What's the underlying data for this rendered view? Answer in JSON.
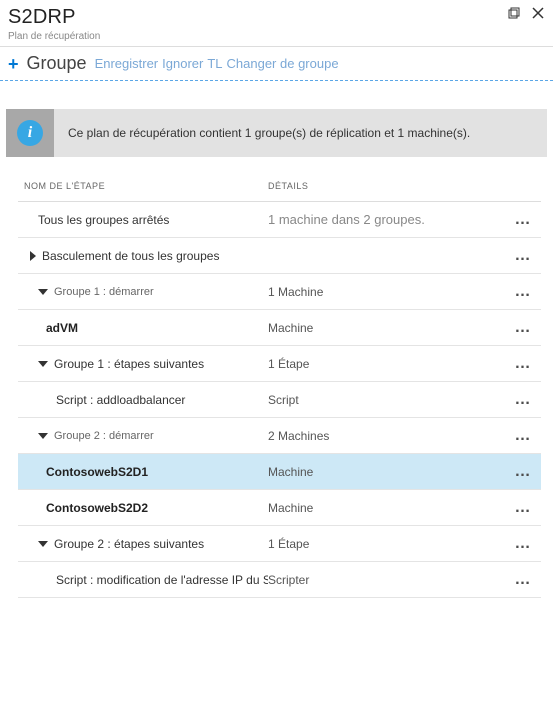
{
  "header": {
    "title": "S2DRP",
    "subtitle": "Plan de récupération"
  },
  "toolbar": {
    "groupe_label": "Groupe",
    "enregistrer": "Enregistrer",
    "ignorer": "Ignorer",
    "tl": "TL",
    "changer": "Changer de groupe"
  },
  "infobox": {
    "text": "Ce plan de récupération contient 1 groupe(s) de réplication et 1 machine(s)."
  },
  "columns": {
    "name": "NOM DE L'ÉTAPE",
    "details": "DÉTAILS"
  },
  "rows": [
    {
      "indent": "ind0",
      "chev": "",
      "name": "Tous les groupes arrêtés",
      "details": "1 machine dans 2 groupes.",
      "details_light": true,
      "bold": false,
      "muted": false,
      "actions": true,
      "selected": false
    },
    {
      "indent": "ind1",
      "chev": "right",
      "name": "Basculement de tous les groupes",
      "details": "",
      "details_light": false,
      "bold": false,
      "muted": false,
      "actions": true,
      "selected": false
    },
    {
      "indent": "ind1b",
      "chev": "down",
      "name": "Groupe 1 : démarrer",
      "details": "1 Machine",
      "details_light": false,
      "bold": false,
      "muted": true,
      "actions": true,
      "selected": false
    },
    {
      "indent": "ind2",
      "chev": "",
      "name": "adVM",
      "details": "Machine",
      "details_light": false,
      "bold": true,
      "muted": false,
      "actions": true,
      "selected": false
    },
    {
      "indent": "ind1b",
      "chev": "down",
      "name": "Groupe 1 : étapes suivantes",
      "details": "1 Étape",
      "details_light": false,
      "bold": false,
      "muted": false,
      "actions": true,
      "selected": false
    },
    {
      "indent": "ind3",
      "chev": "",
      "name": "Script : addloadbalancer",
      "details": "Script",
      "details_light": false,
      "bold": false,
      "muted": false,
      "actions": true,
      "selected": false
    },
    {
      "indent": "ind1b",
      "chev": "down",
      "name": "Groupe 2 : démarrer",
      "details": "2 Machines",
      "details_light": false,
      "bold": false,
      "muted": true,
      "actions": true,
      "selected": false
    },
    {
      "indent": "ind2",
      "chev": "",
      "name": "ContosowebS2D1",
      "details": "Machine",
      "details_light": false,
      "bold": true,
      "muted": false,
      "actions": true,
      "selected": true
    },
    {
      "indent": "ind2",
      "chev": "",
      "name": "ContosowebS2D2",
      "details": "Machine",
      "details_light": false,
      "bold": true,
      "muted": false,
      "actions": true,
      "selected": false
    },
    {
      "indent": "ind1b",
      "chev": "down",
      "name": "Groupe 2 : étapes suivantes",
      "details": "1 Étape",
      "details_light": false,
      "bold": false,
      "muted": false,
      "actions": true,
      "selected": false
    },
    {
      "indent": "ind3",
      "chev": "",
      "name": "Script : modification de l'adresse IP du Scripter",
      "details": "Scripter",
      "details_light": false,
      "bold": false,
      "muted": false,
      "actions": true,
      "selected": false
    }
  ],
  "actions_glyph": "…"
}
